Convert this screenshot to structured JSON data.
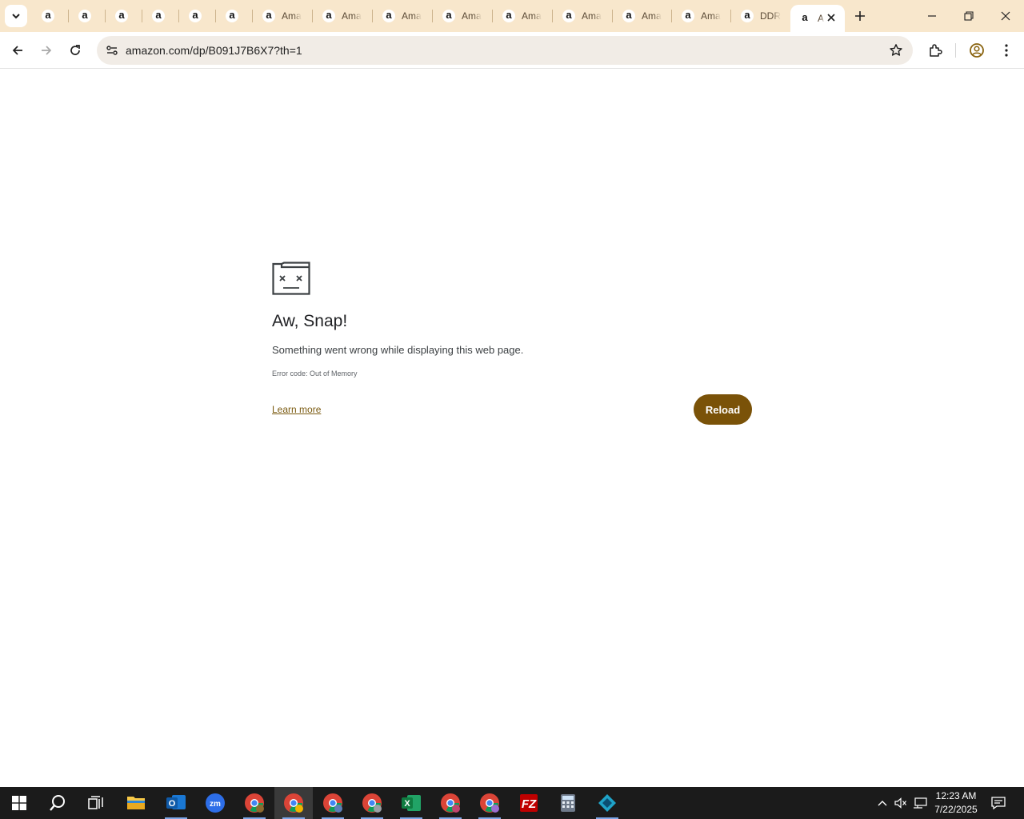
{
  "browser": {
    "tabs": [
      {
        "title": ""
      },
      {
        "title": ""
      },
      {
        "title": ""
      },
      {
        "title": ""
      },
      {
        "title": ""
      },
      {
        "title": ""
      },
      {
        "title": "Ama"
      },
      {
        "title": "Ama"
      },
      {
        "title": "Ama"
      },
      {
        "title": "Ama"
      },
      {
        "title": "Ama"
      },
      {
        "title": "Ama"
      },
      {
        "title": "Ama"
      },
      {
        "title": "Ama"
      }
    ],
    "ddr_tab_title": "DDR",
    "active_tab_title": "A",
    "favicon_glyph": "a",
    "url": "amazon.com/dp/B091J7B6X7?th=1"
  },
  "error_page": {
    "title": "Aw, Snap!",
    "message": "Something went wrong while displaying this web page.",
    "error_code": "Error code: Out of Memory",
    "learn_more": "Learn more",
    "reload": "Reload"
  },
  "taskbar": {
    "time": "12:23 AM",
    "date": "7/22/2025"
  },
  "colors": {
    "tabstrip_bg": "#f8e7cc",
    "accent": "#7a5208",
    "taskbar_bg": "#1b1b1b"
  }
}
